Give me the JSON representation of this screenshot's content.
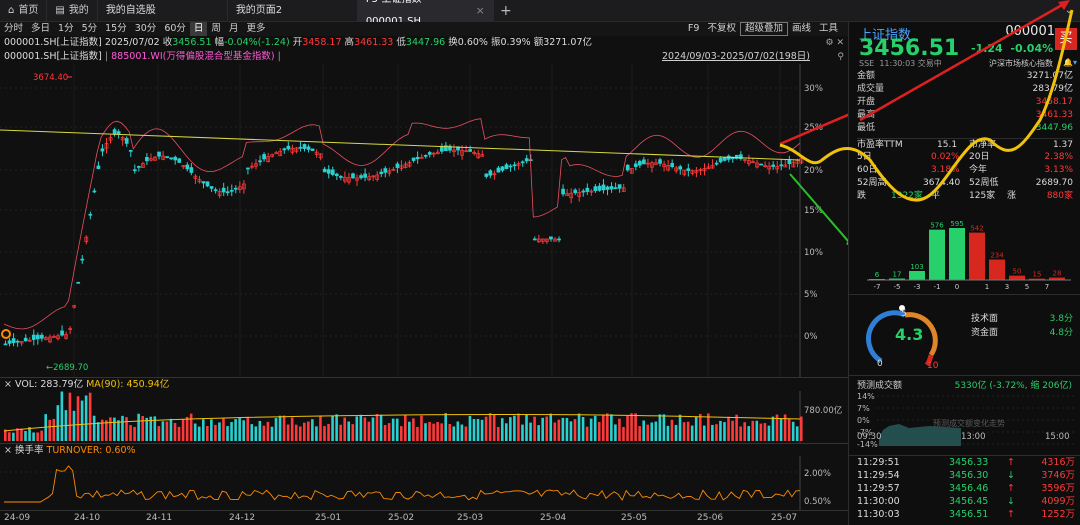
{
  "tabs": [
    {
      "label": "首页",
      "icon": "home-icon"
    },
    {
      "label": "我的",
      "icon": "doc-icon"
    },
    {
      "label": "我的自选股",
      "icon": ""
    },
    {
      "label": "我的页面2",
      "icon": ""
    },
    {
      "label": "F5-上证指数 000001.SH",
      "icon": "",
      "active": true
    }
  ],
  "periods": [
    "分时",
    "多日",
    "1分",
    "5分",
    "15分",
    "30分",
    "60分",
    "日",
    "周",
    "月",
    "更多"
  ],
  "selected_period": "日",
  "right_buttons": [
    "F9",
    "不复权",
    "超级叠加",
    "画线",
    "工具"
  ],
  "info_line": {
    "code": "000001.SH[上证指数]",
    "date": "2025/07/02",
    "close_label": "收",
    "close": "3456.51",
    "change_label": "幅",
    "change": "-0.04%(-1.24)",
    "open_label": "开",
    "open": "3458.17",
    "high_label": "高",
    "high": "3461.33",
    "low_label": "低",
    "low": "3447.96",
    "turnover_label": "换",
    "turnover": "0.60%",
    "amp_label": "振",
    "amp": "0.39%",
    "amount_label": "额",
    "amount": "3271.07亿"
  },
  "overlay_line": {
    "main": "000001.SH[上证指数]",
    "overlay": "885001.WI(万得偏股混合型基金指数)",
    "range": "2024/09/03-2025/07/02(198日)"
  },
  "chart_data": {
    "type": "candlestick",
    "series_note": "000001.SH daily with overlay 885001.WI",
    "high_marker": "3674.40",
    "low_marker": "2689.70",
    "y_right_ticks": [
      "30%",
      "25%",
      "20%",
      "15%",
      "10%",
      "5%",
      "0%"
    ],
    "x_ticks": [
      "24-09",
      "24-10",
      "24-11",
      "24-12",
      "25-01",
      "25-02",
      "25-03",
      "25-04",
      "25-05",
      "25-06",
      "25-07"
    ],
    "trend_line": true,
    "volume": {
      "label": "VOL: 283.79亿",
      "ma_label": "MA(90): 450.94亿",
      "tick": "780.00亿"
    },
    "turnover": {
      "label": "换手率",
      "value_label": "TURNOVER: 0.60%",
      "ticks": [
        "2.00%",
        "0.50%"
      ]
    }
  },
  "panel": {
    "name": "上证指数",
    "code": "000001",
    "price": "3456.51",
    "change": "-1.24",
    "change_pct": "-0.04%",
    "buy": "买",
    "exchange": "SSE",
    "time": "11:30:03",
    "status": "交易中",
    "tag": "沪深市场核心指数",
    "stats": [
      {
        "k": "金额",
        "v": "3271.07亿",
        "c": "w"
      },
      {
        "k": "成交量",
        "v": "283.79亿",
        "c": "w"
      },
      {
        "k": "开盘",
        "v": "3458.17",
        "c": "r"
      },
      {
        "k": "最高",
        "v": "3461.33",
        "c": "r"
      },
      {
        "k": "最低",
        "v": "3447.96",
        "c": "g"
      }
    ],
    "pe_label": "市盈率TTM",
    "pe": "15.1",
    "pb_label": "市净率",
    "pb": "1.37",
    "d5_label": "5日",
    "d5": "0.02%",
    "d20_label": "20日",
    "d20": "2.38%",
    "d60_label": "60日",
    "d60": "3.18%",
    "ytd_label": "今年",
    "ytd": "3.13%",
    "w52h_label": "52周高",
    "w52h": "3674.40",
    "w52l_label": "52周低",
    "w52l": "2689.70",
    "down_label": "跌",
    "down": "1322家",
    "flat_label": "平",
    "flat": "125家",
    "up_label": "涨",
    "up": "880家"
  },
  "distribution": {
    "buckets": [
      "-7",
      "-5",
      "-3",
      "-1",
      "0",
      "1",
      "3",
      "5",
      "7"
    ],
    "values": [
      6,
      17,
      103,
      576,
      595,
      542,
      234,
      50,
      15,
      28
    ],
    "colors": [
      "#27d06a",
      "#27d06a",
      "#27d06a",
      "#27d06a",
      "#27d06a",
      "#d7281f",
      "#d7281f",
      "#d7281f",
      "#d7281f",
      "#d7281f"
    ]
  },
  "gauge": {
    "value": "4.3",
    "min": "0",
    "mid": "5",
    "max": "10",
    "tech_label": "技术面",
    "tech": "3.8分",
    "fund_label": "资金面",
    "fund": "4.8分"
  },
  "prediction": {
    "title": "预测成交额",
    "value": "5330亿 (-3.72%, 缩 206亿)",
    "y_ticks": [
      "14%",
      "7%",
      "0%",
      "-7%",
      "-14%"
    ],
    "x_ticks": [
      "09:30",
      "13:00",
      "15:00"
    ],
    "watermark": "预测成交额变化走势"
  },
  "trades": [
    {
      "time": "11:29:51",
      "price": "3456.33",
      "vol": "4316万"
    },
    {
      "time": "11:29:54",
      "price": "3456.30",
      "vol": "3746万"
    },
    {
      "time": "11:29:57",
      "price": "3456.46",
      "vol": "3596万"
    },
    {
      "time": "11:30:00",
      "price": "3456.45",
      "vol": "4099万"
    },
    {
      "time": "11:30:03",
      "price": "3456.51",
      "vol": "1252万"
    }
  ]
}
